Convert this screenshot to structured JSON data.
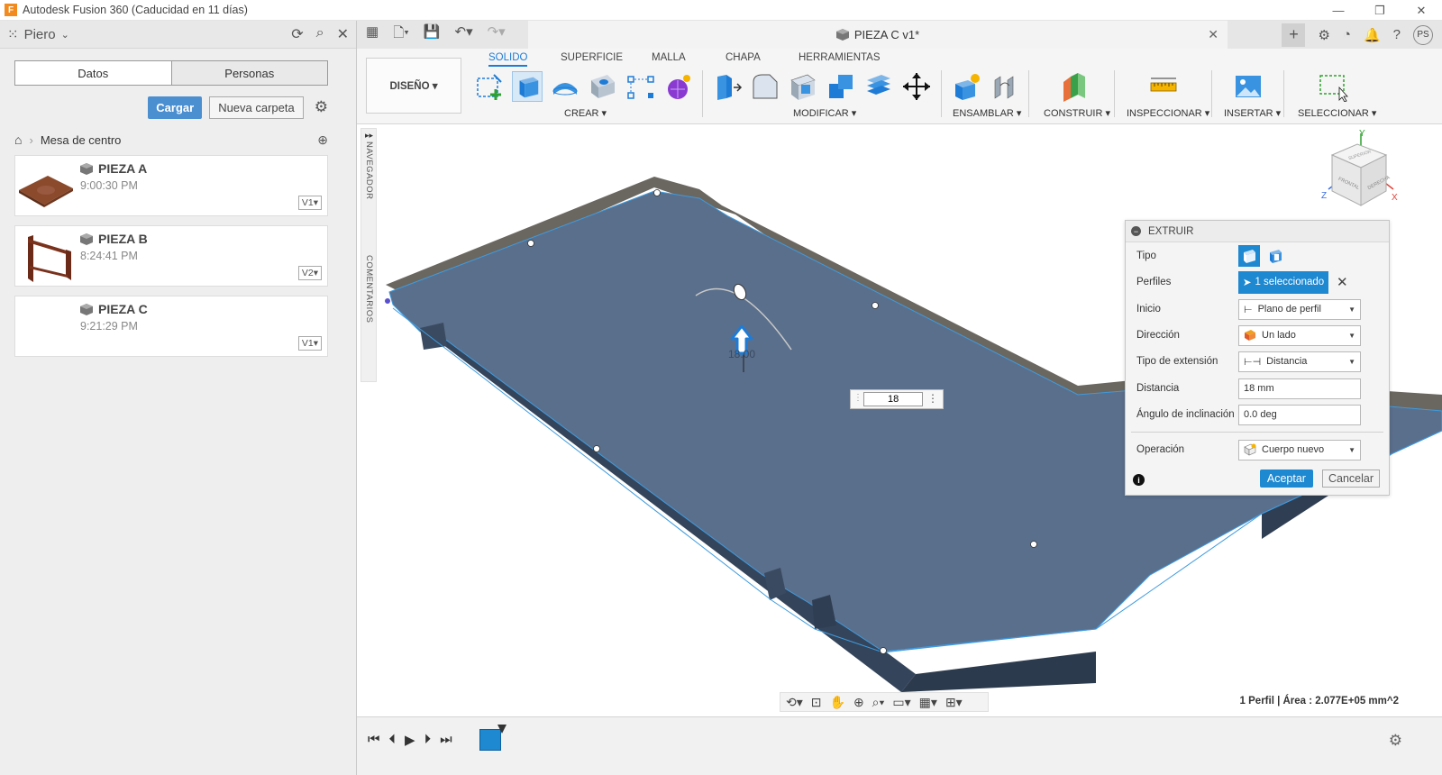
{
  "window": {
    "title": "Autodesk Fusion 360 (Caducidad en 11 días)",
    "app_icon": "F",
    "controls": [
      "—",
      "❐",
      "✕"
    ]
  },
  "data_panel": {
    "user": "Piero",
    "tabs": [
      "Datos",
      "Personas"
    ],
    "upload_label": "Cargar",
    "new_folder_label": "Nueva carpeta",
    "breadcrumb": "Mesa de centro",
    "files": [
      {
        "name": "PIEZA A",
        "time": "9:00:30 PM",
        "version": "V1▾"
      },
      {
        "name": "PIEZA B",
        "time": "8:24:41 PM",
        "version": "V2▾"
      },
      {
        "name": "PIEZA C",
        "time": "9:21:29 PM",
        "version": "V1▾"
      }
    ]
  },
  "document_tab": {
    "title": "PIEZA C v1*"
  },
  "user_initials": "PS",
  "ribbon": {
    "workspace": "DISEÑO ▾",
    "tabs": [
      "SOLIDO",
      "SUPERFICIE",
      "MALLA",
      "CHAPA",
      "HERRAMIENTAS"
    ],
    "active_tab": "SOLIDO",
    "groups": [
      "CREAR ▾",
      "MODIFICAR ▾",
      "ENSAMBLAR ▾",
      "CONSTRUIR ▾",
      "INSPECCIONAR ▾",
      "INSERTAR ▾",
      "SELECCIONAR ▾"
    ]
  },
  "side_strip": {
    "navigator": "NAVEGADOR",
    "comments": "COMENTARIOS"
  },
  "viewcube": {
    "top": "SUPERIOR",
    "front": "FRONTAL",
    "right": "DERECHA",
    "axis_x": "X",
    "axis_y": "Y",
    "axis_z": "Z"
  },
  "viewport": {
    "manipulator_label": "18.00",
    "distance_input": "18"
  },
  "extrude_dialog": {
    "title": "EXTRUIR",
    "rows": {
      "tipo": "Tipo",
      "perfiles": "Perfiles",
      "perfiles_value": "1 seleccionado",
      "inicio": "Inicio",
      "inicio_value": "Plano de perfil",
      "direccion": "Dirección",
      "direccion_value": "Un lado",
      "tipo_extension": "Tipo de extensión",
      "tipo_extension_value": "Distancia",
      "distancia": "Distancia",
      "distancia_value": "18 mm",
      "angulo": "Ángulo de inclinación",
      "angulo_value": "0.0 deg",
      "operacion": "Operación",
      "operacion_value": "Cuerpo nuevo"
    },
    "ok_label": "Aceptar",
    "cancel_label": "Cancelar"
  },
  "status": {
    "text": "1 Perfil | Área : 2.077E+05 mm^2"
  },
  "colors": {
    "accent": "#1e88d0",
    "body_top": "#5a6f8c",
    "body_side": "#2f3e52",
    "body_edge": "#6a6660"
  }
}
